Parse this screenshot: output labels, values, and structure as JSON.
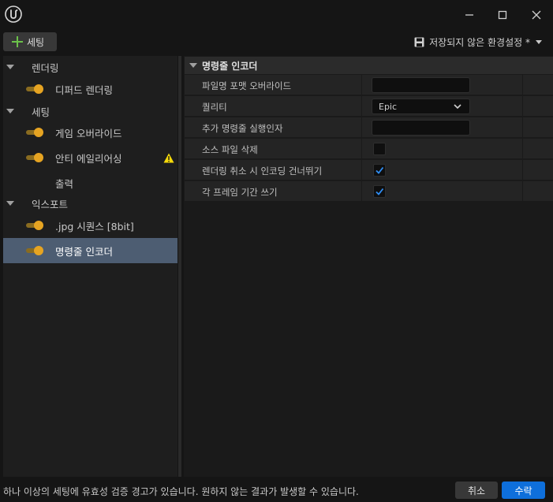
{
  "window": {
    "minimize_icon": "minimize-icon",
    "maximize_icon": "maximize-icon",
    "close_icon": "close-icon"
  },
  "toolbar": {
    "add_label": "세팅",
    "preset_label": "저장되지 않은 환경설정 *"
  },
  "sidebar": {
    "groups": [
      {
        "label": "렌더링",
        "items": [
          {
            "label": "디퍼드 렌더링",
            "enabled": true,
            "warning": false
          }
        ]
      },
      {
        "label": "세팅",
        "items": [
          {
            "label": "게임 오버라이드",
            "enabled": true,
            "warning": false
          },
          {
            "label": "안티 에일리어싱",
            "enabled": true,
            "warning": true
          },
          {
            "label": "출력",
            "enabled": null,
            "warning": false
          }
        ]
      },
      {
        "label": "익스포트",
        "items": [
          {
            "label": ".jpg 시퀀스 [8bit]",
            "enabled": true,
            "warning": false
          },
          {
            "label": "명령줄 인코더",
            "enabled": true,
            "warning": false,
            "selected": true
          }
        ]
      }
    ]
  },
  "details": {
    "section_title": "명령줄 인코더",
    "properties": [
      {
        "label": "파일명 포맷 오버라이드",
        "type": "text",
        "value": ""
      },
      {
        "label": "퀄리티",
        "type": "combo",
        "value": "Epic"
      },
      {
        "label": "추가 명령줄 실행인자",
        "type": "text",
        "value": ""
      },
      {
        "label": "소스 파일 삭제",
        "type": "checkbox",
        "checked": false
      },
      {
        "label": "렌더링 취소 시 인코딩 건너뛰기",
        "type": "checkbox",
        "checked": true
      },
      {
        "label": "각 프레임 기간 쓰기",
        "type": "checkbox",
        "checked": true
      }
    ]
  },
  "footer": {
    "message": "하나 이상의 세팅에 유효성 검증 경고가 있습니다. 원하지 않는 결과가 발생할 수 있습니다.",
    "cancel_label": "취소",
    "accept_label": "수락"
  },
  "colors": {
    "accent_blue": "#0e6fdb",
    "toggle_on": "#e6a422",
    "selection": "#4d5d72",
    "warning": "#f5d90a",
    "add_green": "#6bc14a"
  }
}
